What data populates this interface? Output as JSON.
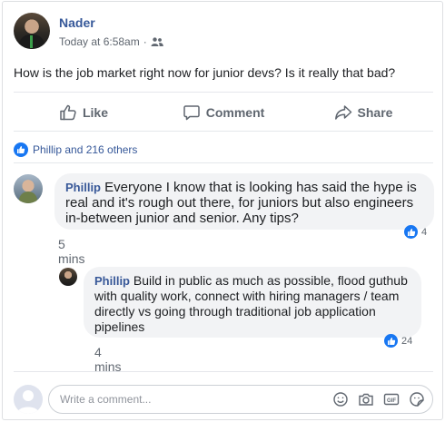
{
  "post": {
    "author": "Nader",
    "timestamp": "Today at 6:58am",
    "separator": "·",
    "text": "How is the job market right now for junior devs? Is it really that bad?"
  },
  "actions": {
    "like": "Like",
    "comment": "Comment",
    "share": "Share"
  },
  "reactions": {
    "summary": "Phillip and 216 others"
  },
  "comments": [
    {
      "author": "Phillip",
      "text": "Everyone I know that is looking has said the hype is real and it's rough out there, for juniors but also engineers in-between junior and senior. Any tips?",
      "time": "5 mins",
      "likes": "4"
    },
    {
      "author": "Phillip",
      "text": "Build in public as much as possible, flood guthub with quality work, connect with hiring managers / team directly vs going through traditional job application pipelines",
      "time": "4 mins",
      "likes": "24"
    }
  ],
  "composer": {
    "placeholder": "Write a comment..."
  },
  "colors": {
    "link_blue": "#365899",
    "like_blue": "#1877f2",
    "muted": "#606770",
    "bubble": "#f2f3f5"
  },
  "icons": {
    "audience": "friends-icon",
    "like": "thumbs-up-icon",
    "comment": "speech-bubble-icon",
    "share": "share-arrow-icon",
    "composer": [
      "emoji-icon",
      "camera-icon",
      "gif-icon",
      "sticker-icon"
    ]
  }
}
